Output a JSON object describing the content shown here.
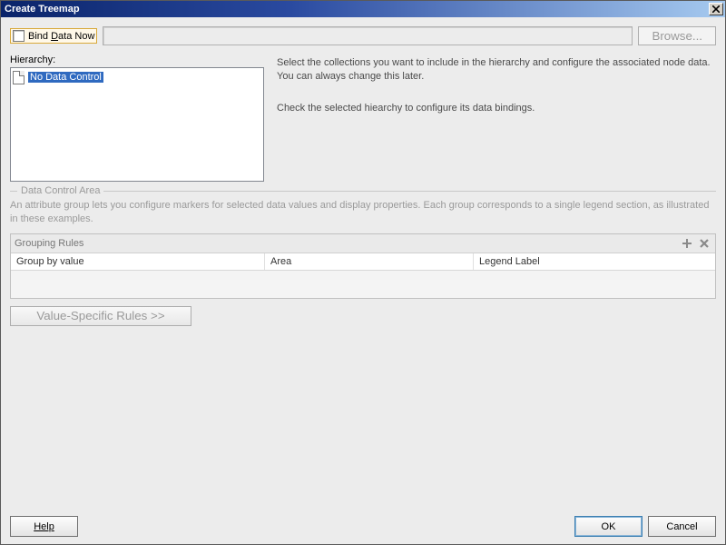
{
  "window": {
    "title": "Create Treemap"
  },
  "top": {
    "bind_label_pre": "Bind ",
    "bind_label_ul": "D",
    "bind_label_post": "ata Now",
    "path_value": "",
    "browse_label": "Browse..."
  },
  "hierarchy": {
    "label": "Hierarchy:",
    "items": [
      {
        "text": "No Data Control",
        "selected": true
      }
    ]
  },
  "description": {
    "line1": "Select the collections you want to include in the hierarchy and configure the associated node data. You can always change this later.",
    "line2": "Check the selected hiearchy to configure its data bindings."
  },
  "data_control": {
    "legend": "Data Control Area",
    "attr_desc": "An attribute group lets you configure markers for selected data values and display properties. Each group corresponds to a single legend section, as illustrated in these examples.",
    "grouping_title": "Grouping Rules",
    "columns": [
      "Group by value",
      "Area",
      "Legend Label"
    ],
    "value_rules_label": "Value-Specific Rules >>"
  },
  "buttons": {
    "help": "Help",
    "ok": "OK",
    "cancel": "Cancel"
  }
}
